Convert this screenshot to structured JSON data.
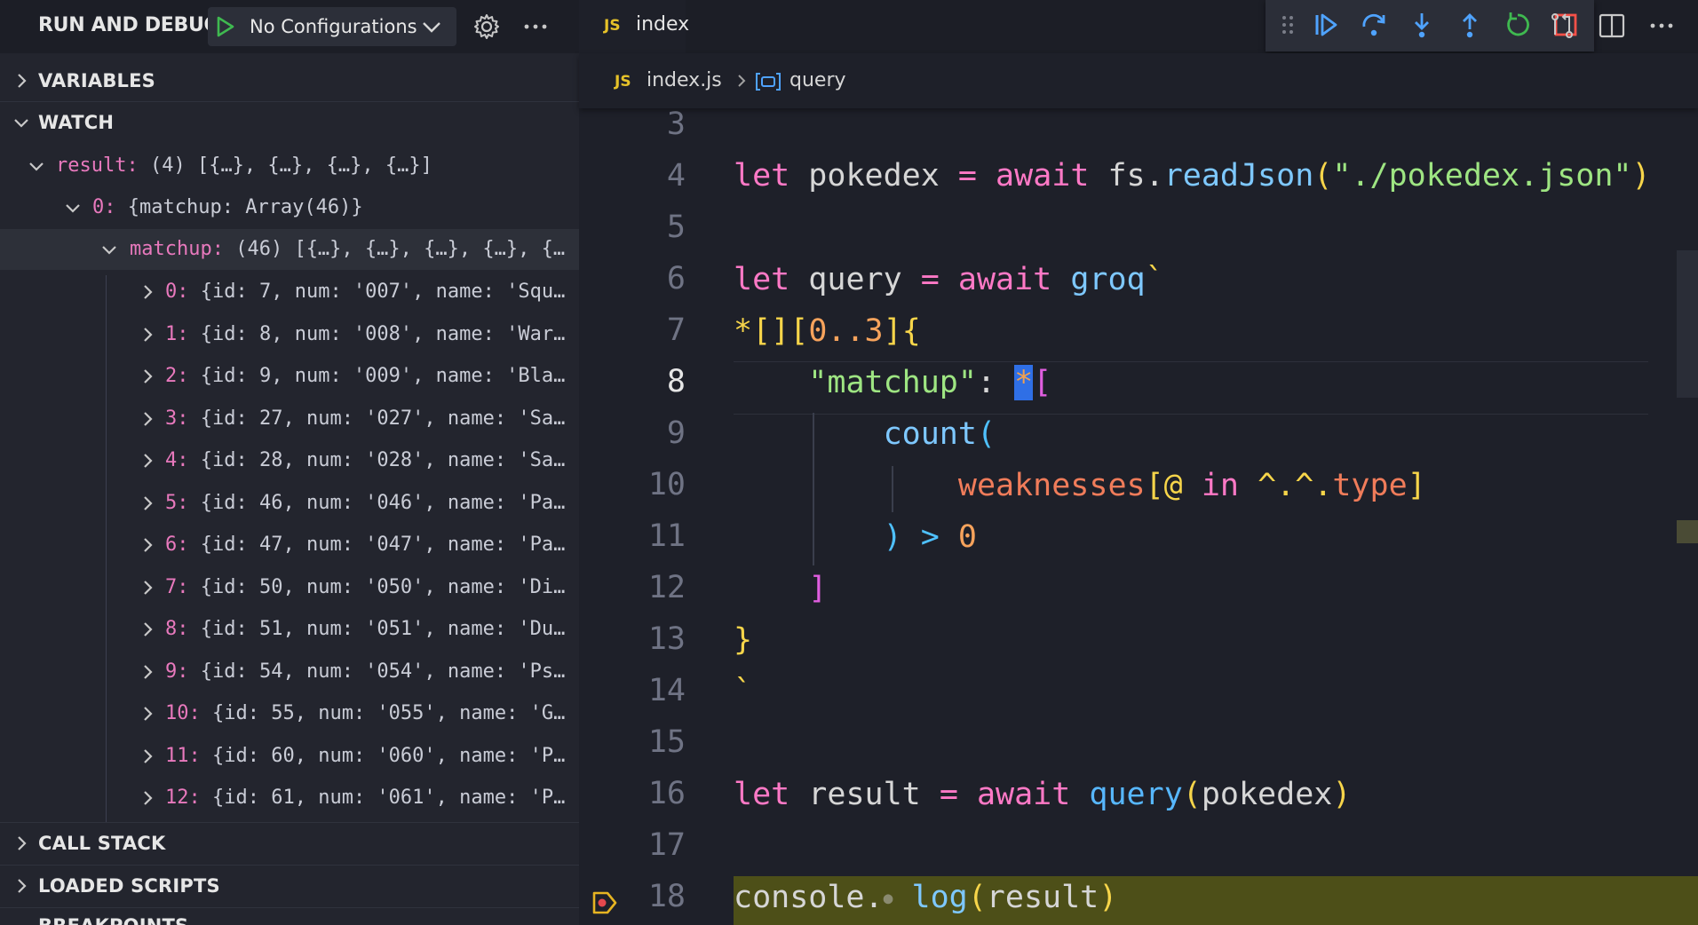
{
  "sidebar": {
    "title": "RUN AND DEBUG",
    "config_label": "No Configurations",
    "sections": {
      "variables": "VARIABLES",
      "watch": "WATCH",
      "call_stack": "CALL STACK",
      "loaded_scripts": "LOADED SCRIPTS",
      "breakpoints": "BREAKPOINTS"
    },
    "watch": {
      "result_key": "result:",
      "result_val": "(4) [{…}, {…}, {…}, {…}]",
      "item0_key": "0:",
      "item0_val": "{matchup: Array(46)}",
      "matchup_key": "matchup:",
      "matchup_val": "(46) [{…}, {…}, {…}, {…}, {…",
      "items": [
        {
          "key": "0:",
          "val": "{id: 7, num: '007', name: 'Squ…"
        },
        {
          "key": "1:",
          "val": "{id: 8, num: '008', name: 'War…"
        },
        {
          "key": "2:",
          "val": "{id: 9, num: '009', name: 'Bla…"
        },
        {
          "key": "3:",
          "val": "{id: 27, num: '027', name: 'Sa…"
        },
        {
          "key": "4:",
          "val": "{id: 28, num: '028', name: 'Sa…"
        },
        {
          "key": "5:",
          "val": "{id: 46, num: '046', name: 'Pa…"
        },
        {
          "key": "6:",
          "val": "{id: 47, num: '047', name: 'Pa…"
        },
        {
          "key": "7:",
          "val": "{id: 50, num: '050', name: 'Di…"
        },
        {
          "key": "8:",
          "val": "{id: 51, num: '051', name: 'Du…"
        },
        {
          "key": "9:",
          "val": "{id: 54, num: '054', name: 'Ps…"
        },
        {
          "key": "10:",
          "val": "{id: 55, num: '055', name: 'G…"
        },
        {
          "key": "11:",
          "val": "{id: 60, num: '060', name: 'P…"
        },
        {
          "key": "12:",
          "val": "{id: 61, num: '061', name: 'P…"
        }
      ]
    }
  },
  "editor": {
    "tab_badge": "JS",
    "tab_label": "index",
    "breadcrumb": {
      "badge": "JS",
      "file": "index.js",
      "symbol": "query"
    },
    "line_numbers": [
      "3",
      "4",
      "5",
      "6",
      "7",
      "8",
      "9",
      "10",
      "11",
      "12",
      "13",
      "14",
      "15",
      "16",
      "17",
      "18"
    ],
    "tokens": {
      "let": "let",
      "await": "await",
      "eq": "=",
      "pokedex": "pokedex",
      "fs": "fs.",
      "readJson": "readJson",
      "paren_open": "(",
      "paren_close": ")",
      "path_str": "\"./pokedex.json\"",
      "query": "query",
      "groq": "groq",
      "backtick": "`",
      "star": "*",
      "brackets": "[]",
      "bracket_open": "[",
      "bracket_close": "]",
      "range_zero": "0",
      "range_dots": "..",
      "range_three": "3",
      "brace_open": "{",
      "brace_close": "}",
      "matchup_str": "\"matchup\"",
      "colon": ":",
      "cursor_char": "*",
      "count": "count",
      "weaknesses": "weaknesses",
      "at": "@",
      "in": "in",
      "caret_path": "^.^.",
      "type": "type",
      "gt": ">",
      "zero": "0",
      "result": "result",
      "console": "console.",
      "dot_marker": "●",
      "log": "log"
    }
  },
  "colors": {
    "accent": "#2f6fe6",
    "debug_line": "#4d4f18",
    "play_green": "#3fb950",
    "stop_red": "#f85149"
  }
}
